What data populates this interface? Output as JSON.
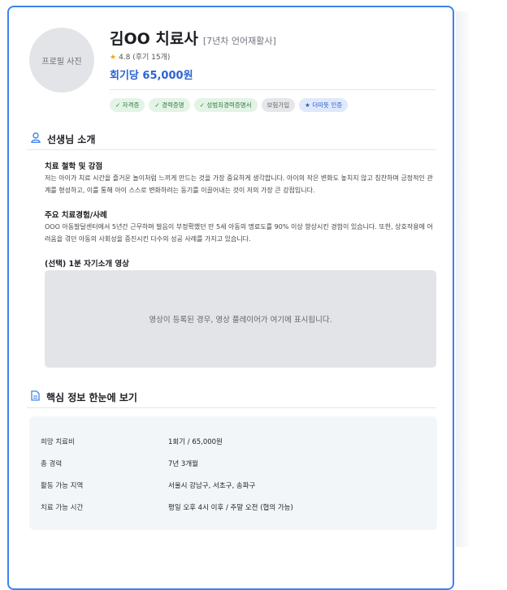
{
  "profile": {
    "photo_label": "프로필 사진",
    "name": "김OO 치료사",
    "subtitle": "[7년차 언어재활사]",
    "rating": "4.8 (후기 15개)",
    "price": "회기당 65,000원",
    "badges": [
      {
        "label": "✓ 자격증",
        "style": "green"
      },
      {
        "label": "✓ 경력증명",
        "style": "green"
      },
      {
        "label": "✓ 성범죄경력증명서",
        "style": "green"
      },
      {
        "label": "보험가입",
        "style": "gray"
      },
      {
        "label": "★ 더따뜻 인증",
        "style": "blue"
      }
    ]
  },
  "intro": {
    "title": "선생님 소개",
    "philosophy_title": "치료 철학 및 강점",
    "philosophy_text": "저는 아이가 치료 시간을 즐거운 놀이처럼 느끼게 만드는 것을 가장 중요하게 생각합니다. 아이의 작은 변화도 놓치지 않고 칭찬하며 긍정적인 관계를 형성하고, 이를 통해 아이 스스로 변화하려는 동기를 이끌어내는 것이 저의 가장 큰 강점입니다.",
    "experience_title": "주요 치료경험/사례",
    "experience_text": "OOO 아동발달센터에서 5년간 근무하며 발음이 부정확했던 만 5세 아동의 명료도를 90% 이상 향상시킨 경험이 있습니다. 또한, 상호작용에 어려움을 겪던 아동의 사회성을 증진시킨 다수의 성공 사례를 가지고 있습니다.",
    "video_title": "(선택) 1분 자기소개 영상",
    "video_placeholder": "영상이 등록된 경우, 영상 플레이어가 여기에 표시됩니다."
  },
  "summary": {
    "title": "핵심 정보 한눈에 보기",
    "rows": [
      {
        "key": "희망 치료비",
        "value": "1회기 / 65,000원"
      },
      {
        "key": "총 경력",
        "value": "7년 3개월"
      },
      {
        "key": "활동 가능 지역",
        "value": "서울시 강남구, 서초구, 송파구"
      },
      {
        "key": "치료 가능 시간",
        "value": "평일 오후 4시 이후 / 주말 오전 (협의 가능)"
      }
    ]
  },
  "icons": {
    "rating": "star-icon",
    "intro": "person-icon",
    "summary": "document-icon"
  },
  "colors": {
    "accent": "#3d83f0",
    "price": "#2a64d4"
  }
}
